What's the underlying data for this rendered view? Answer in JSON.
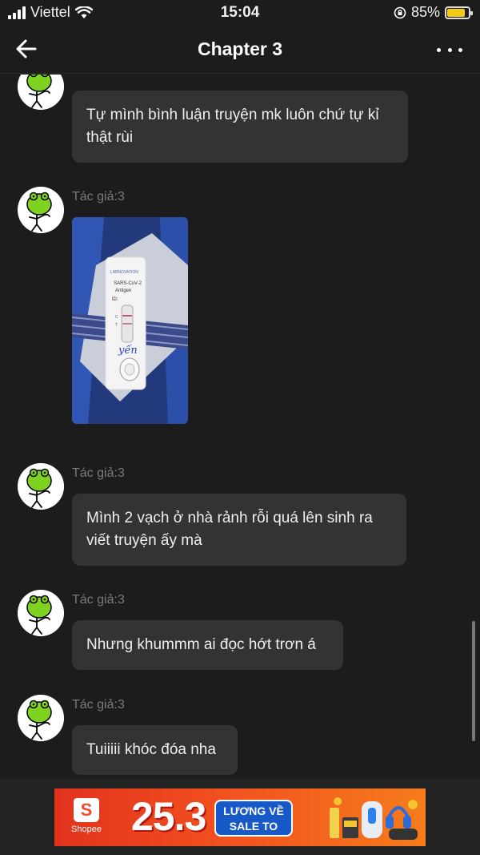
{
  "status_bar": {
    "carrier": "Viettel",
    "time": "15:04",
    "battery_percent": "85%",
    "battery_level": 0.85
  },
  "header": {
    "title": "Chapter 3"
  },
  "messages": [
    {
      "author": "Tác giả:3",
      "text": "Tự mình bình luận truyện mk luôn chứ tự kỉ thật rùi"
    },
    {
      "author": "Tác giả:3",
      "type": "image"
    },
    {
      "author": "Tác giả:3",
      "text": "Mình 2 vạch ở nhà rảnh rỗi quá lên sinh ra viết truyện ấy mà"
    },
    {
      "author": "Tác giả:3",
      "text": "Nhưng khummm ai đọc hớt trơn á"
    },
    {
      "author": "Tác giả:3",
      "text": "Tuiiiii khóc đóa nha"
    }
  ],
  "photo": {
    "test_brand": "LABNOVATION",
    "test_name": "SARS-CoV-2 Antigen",
    "test_id": "ID:",
    "marks": "C T",
    "handwriting": "yến"
  },
  "ad": {
    "brand": "Shopee",
    "date": "25.3",
    "tag_line1": "LƯƠNG VỀ",
    "tag_line2": "SALE TO"
  },
  "colors": {
    "background": "#1c1c1c",
    "bubble": "#333333",
    "author": "#7a7a7a",
    "avatar_green": "#7ed321",
    "ad_orange": "#ee4d2d",
    "battery": "#f6c913"
  },
  "icons": {
    "back": "arrow-left-icon",
    "more": "more-horizontal-icon",
    "wifi": "wifi-icon",
    "signal": "signal-icon",
    "lock": "orientation-lock-icon",
    "battery": "battery-icon"
  }
}
